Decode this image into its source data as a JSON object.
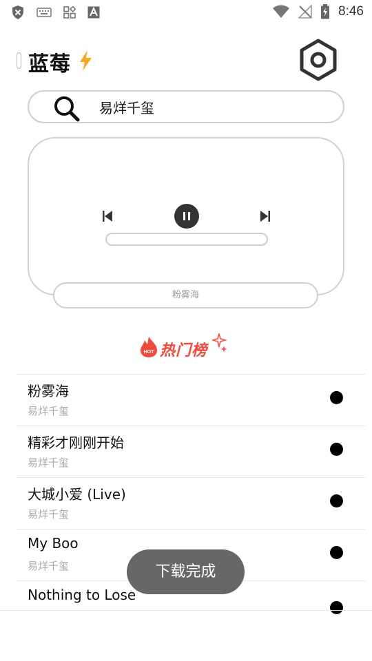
{
  "status_bar": {
    "time": "8:46",
    "left_icons": [
      "shield-icon",
      "keyboard-icon",
      "apps-icon",
      "font-icon"
    ],
    "right_icons": [
      "wifi-icon",
      "signal-off-icon",
      "battery-charging-icon"
    ]
  },
  "header": {
    "title": "蓝莓",
    "settings_icon": "hexagon-settings-icon"
  },
  "search": {
    "value": "易烊千玺"
  },
  "player": {
    "now_playing": "粉雾海",
    "progress": 0
  },
  "hot_section": {
    "label": "热门榜",
    "badge": "HOT",
    "accent_color": "#f04a3c"
  },
  "songs": [
    {
      "title": "粉雾海",
      "artist": "易烊千玺"
    },
    {
      "title": "精彩才刚刚开始",
      "artist": "易烊千玺"
    },
    {
      "title": "大城小爱 (Live)",
      "artist": "易烊千玺"
    },
    {
      "title": "My Boo",
      "artist": "易烊千玺"
    },
    {
      "title": "Nothing to Lose",
      "artist": ""
    }
  ],
  "toast": {
    "message": "下载完成"
  }
}
